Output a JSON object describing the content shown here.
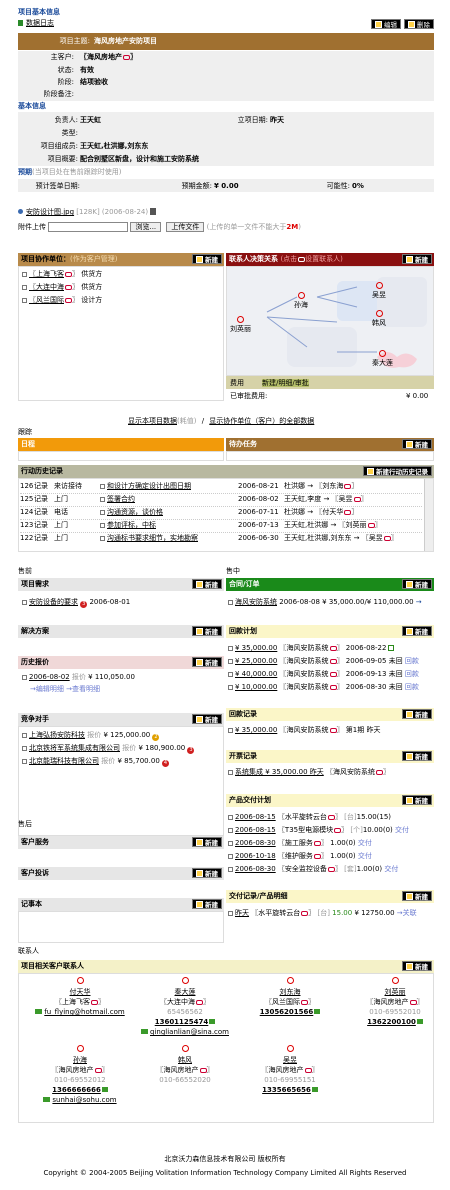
{
  "project": {
    "section_title": "项目基本信息",
    "log_link": "数据日志",
    "edit": "编辑",
    "delete": "删除",
    "theme_label": "项目主题:",
    "theme_value": "海风房地产安防项目",
    "customer_label": "主客户:",
    "customer_value": "〖海风房地产",
    "status_label": "状态:",
    "status_value": "有效",
    "stage_label": "阶段:",
    "stage_value": "结项验收",
    "stage_note_label": "阶段备注:"
  },
  "basic": {
    "title": "基本信息",
    "owner_label": "负责人:",
    "owner_value": "王天虹",
    "date_label": "立项日期:",
    "date_value": "昨天",
    "type_label": "类型:",
    "members_label": "项目组成员:",
    "members_value": "王天虹,杜洪娜,刘东东",
    "summary_label": "项目概要:",
    "summary_value": "配合别墅区新盘，设计和施工安防系统"
  },
  "forecast": {
    "title": "预期",
    "note": "(当项目处在售前跟踪时使用)",
    "sign_label": "预计签单日期:",
    "amount_label": "预期金额:",
    "amount_value": "¥ 0.00",
    "prob_label": "可能性:",
    "prob_value": "0%"
  },
  "attach": {
    "file": "安防设计图.jpg",
    "meta": "[128K] (2006-08-24)",
    "upload_label": "附件上传",
    "browse": "浏览...",
    "upload_btn": "上传文件",
    "upload_note": "(上传的单一文件不能大于",
    "upload_limit": "2M",
    ")": ")"
  },
  "partners": {
    "title": "项目协作单位：",
    "hint": "(作为客户管理)",
    "new": "新建",
    "items": [
      {
        "name": "〖上海飞客",
        "role": "供货方"
      },
      {
        "name": "〖大连中海",
        "role": "供货方"
      },
      {
        "name": "〖风兰国际",
        "role": "设计方"
      }
    ]
  },
  "decision": {
    "title": "联系人决策关系",
    "hint": "(点击",
    "hint2": "设置联系人)",
    "new": "新建",
    "nodes": [
      "孙海",
      "刘英丽",
      "吴昱",
      "韩风",
      "秦大莲"
    ],
    "cost_label": "费用",
    "cost_link": "新建/明细/审批",
    "approved_label": "已审批费用:",
    "approved_value": "¥ 0.00"
  },
  "links": {
    "show_project": "显示本项目数据",
    "cost": "(耗值)",
    "sep": "/",
    "show_partner": "显示协作单位（客户）的全部数据"
  },
  "track": {
    "title": "跟踪",
    "schedule": "日程",
    "tasks": "待办任务",
    "new": "新建"
  },
  "history": {
    "title": "行动历史记录",
    "new": "新建行动历史记录",
    "rows": [
      {
        "no": "126",
        "kind": "记录",
        "mode": "来访接待",
        "subject": "和设计方确定设计出图日期",
        "date": "2006-08-21",
        "who": "杜洪娜 → 〖刘东海"
      },
      {
        "no": "125",
        "kind": "记录",
        "mode": "上门",
        "subject": "签署合约",
        "date": "2006-08-02",
        "who": "王天虹,李度 → 〖吴昱"
      },
      {
        "no": "124",
        "kind": "记录",
        "mode": "电话",
        "subject": "沟通资源，谈价格",
        "date": "2006-07-11",
        "who": "杜洪娜 → 〖付天华"
      },
      {
        "no": "123",
        "kind": "记录",
        "mode": "上门",
        "subject": "参加评标，中标",
        "date": "2006-07-13",
        "who": "王天虹,杜洪娜 → 〖刘英丽"
      },
      {
        "no": "122",
        "kind": "记录",
        "mode": "上门",
        "subject": "沟通标书要求细节，实地勘察",
        "date": "2006-06-30",
        "who": "王天虹,杜洪娜,刘东东 → 〖吴昱"
      }
    ]
  },
  "presale": {
    "title": "售前",
    "demand_title": "项目需求",
    "demand_item": "安防设备的要求",
    "demand_date": "2006-08-01",
    "solution_title": "解决方案",
    "quote_title": "历史报价",
    "quote_date": "2006-08-02",
    "quote_label": "报价",
    "quote_value": "¥ 110,050.00",
    "quote_edit": "编辑明细",
    "quote_view": "查看明细",
    "comp_title": "竞争对手",
    "competitors": [
      {
        "name": "上海弘扬安防科技",
        "label": "报价",
        "price": "¥ 125,000.00"
      },
      {
        "name": "北京铁将军系统集成有限公司",
        "label": "报价",
        "price": "¥ 180,900.00"
      },
      {
        "name": "北京能瑞科技有限公司",
        "label": "报价",
        "price": "¥ 85,700.00"
      }
    ],
    "new": "新建"
  },
  "sale": {
    "title": "售中",
    "contract_title": "合同/订单",
    "contract_item": "海风安防系统",
    "contract_detail": "2006-08-08 ¥ 35,000.00/¥ 110,000.00",
    "payplan_title": "回款计划",
    "payplan": [
      {
        "amt": "¥ 35,000.00",
        "cust": "〖海风安防系统",
        "date": "2006-08-22",
        "st": ""
      },
      {
        "amt": "¥ 25,000.00",
        "cust": "〖海风安防系统",
        "date": "2006-09-05 未回",
        "st": "回款"
      },
      {
        "amt": "¥ 40,000.00",
        "cust": "〖海风安防系统",
        "date": "2006-09-13 未回",
        "st": "回款"
      },
      {
        "amt": "¥ 10,000.00",
        "cust": "〖海风安防系统",
        "date": "2006-08-30 未回",
        "st": "回款"
      }
    ],
    "payrec_title": "回款记录",
    "payrec_item": "¥ 35,000.00",
    "payrec_cust": "〖海风安防系统",
    "payrec_note": "第1期 昨天",
    "invoice_title": "开票记录",
    "invoice_item": "系统集成 ¥ 35,000.00 昨天",
    "invoice_cust": "〖海风安防系统",
    "delivery_title": "产品交付计划",
    "deliveries": [
      {
        "date": "2006-08-15",
        "prod": "〖水平旋转云台",
        "unit": "[台]",
        "qty": "15.00(15)",
        "st": ""
      },
      {
        "date": "2006-08-15",
        "prod": "〖T35型电源模块",
        "unit": "[个]",
        "qty": "10.00(0)",
        "st": "交付"
      },
      {
        "date": "2006-08-30",
        "prod": "〖施工服务",
        "unit": "",
        "qty": "1.00(0)",
        "st": "交付"
      },
      {
        "date": "2006-10-18",
        "prod": "〖维护服务",
        "unit": "",
        "qty": "1.00(0)",
        "st": "交付"
      },
      {
        "date": "2006-08-30",
        "prod": "〖安全监控设备",
        "unit": "[套]",
        "qty": "1.00(0)",
        "st": "交付"
      }
    ],
    "deliv_rec_title": "交付记录/产品明细",
    "deliv_rec": "昨天",
    "deliv_prod": "〖水平旋转云台",
    "deliv_info": "[台]",
    "deliv_qty": "15.00",
    "deliv_amt": "¥ 12750.00",
    "deliv_st": "关联",
    "new": "新建"
  },
  "aftersale": {
    "title": "售后",
    "service": "客户服务",
    "complaint": "客户投诉",
    "memo": "记事本",
    "new": "新建"
  },
  "contacts": {
    "title": "联系人",
    "panel_title": "项目相关客户联系人",
    "new": "新建",
    "people": [
      {
        "name": "付天华",
        "org": "〖上海飞客",
        "phone": "",
        "mobile": "",
        "email": "fu_flying@hotmail.com"
      },
      {
        "name": "秦大莲",
        "org": "〖大连中海",
        "phone": "65456562",
        "mobile": "13601125474",
        "email": "qinglianlian@sina.com"
      },
      {
        "name": "刘东海",
        "org": "〖风兰国际",
        "phone": "",
        "mobile": "13056201566",
        "email": ""
      },
      {
        "name": "刘英丽",
        "org": "〖海风房地产",
        "phone": "010-69552010",
        "mobile": "1362200100",
        "email": ""
      },
      {
        "name": "孙海",
        "org": "〖海风房地产",
        "phone": "010-69552012",
        "mobile": "1366666666",
        "email": "sunhai@sohu.com"
      },
      {
        "name": "韩风",
        "org": "〖海风房地产",
        "phone": "010-66552020",
        "mobile": "",
        "email": ""
      },
      {
        "name": "吴昱",
        "org": "〖海风房地产",
        "phone": "010-69955151",
        "mobile": "1335665656",
        "email": ""
      }
    ]
  },
  "footer": {
    "company": "北京沃力森信息技术有限公司  版权所有",
    "copyright": "Copyright © 2004-2005 Beijing Volitation Information Technology Company Limited All Rights Reserved"
  }
}
